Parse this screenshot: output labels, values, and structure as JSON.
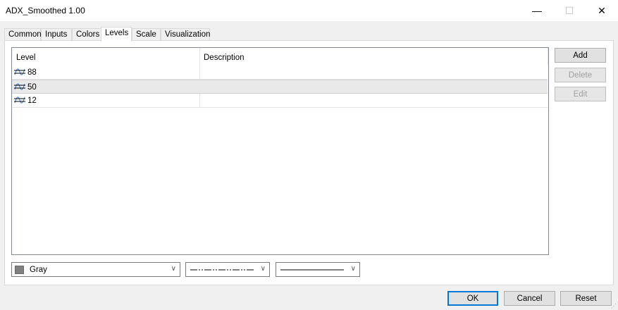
{
  "window": {
    "title": "ADX_Smoothed 1.00",
    "minimize": "—",
    "maximize": "☐",
    "close": "✕"
  },
  "tabs": [
    {
      "label": "Common"
    },
    {
      "label": "Inputs"
    },
    {
      "label": "Colors"
    },
    {
      "label": "Levels",
      "active": true
    },
    {
      "label": "Scale"
    },
    {
      "label": "Visualization"
    }
  ],
  "levels": {
    "columns": {
      "level": "Level",
      "description": "Description"
    },
    "rows": [
      {
        "level": "88",
        "description": ""
      },
      {
        "level": "50",
        "description": "",
        "selected": true
      },
      {
        "level": "12",
        "description": ""
      }
    ]
  },
  "side_buttons": {
    "add": "Add",
    "delete": "Delete",
    "edit": "Edit"
  },
  "style": {
    "color_label": "Gray",
    "color_hex": "#808080",
    "line_style": "dash-dot-dot",
    "line_width": "solid"
  },
  "footer": {
    "ok": "OK",
    "cancel": "Cancel",
    "reset": "Reset"
  }
}
